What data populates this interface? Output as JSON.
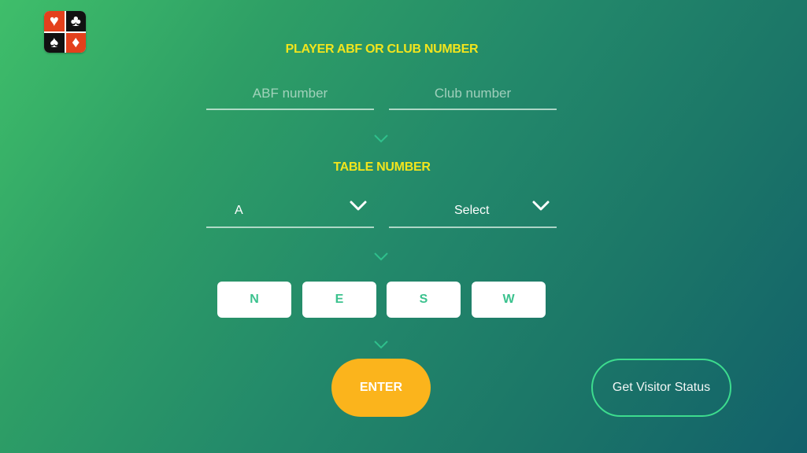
{
  "logo": {
    "suits": [
      "♥",
      "♣",
      "♠",
      "♦"
    ]
  },
  "player_section": {
    "title": "PLAYER ABF OR CLUB NUMBER",
    "abf_placeholder": "ABF number",
    "abf_value": "",
    "club_placeholder": "Club number",
    "club_value": ""
  },
  "table_section": {
    "title": "TABLE NUMBER",
    "section_select_value": "A",
    "table_select_value": "Select"
  },
  "seats": {
    "north": "N",
    "east": "E",
    "south": "S",
    "west": "W"
  },
  "actions": {
    "enter_label": "ENTER",
    "visitor_label": "Get Visitor Status"
  },
  "colors": {
    "title_yellow": "#f2e51d",
    "enter_orange": "#fbb41c",
    "visitor_border": "#3ddc8e",
    "seat_text": "#3bc28e"
  }
}
